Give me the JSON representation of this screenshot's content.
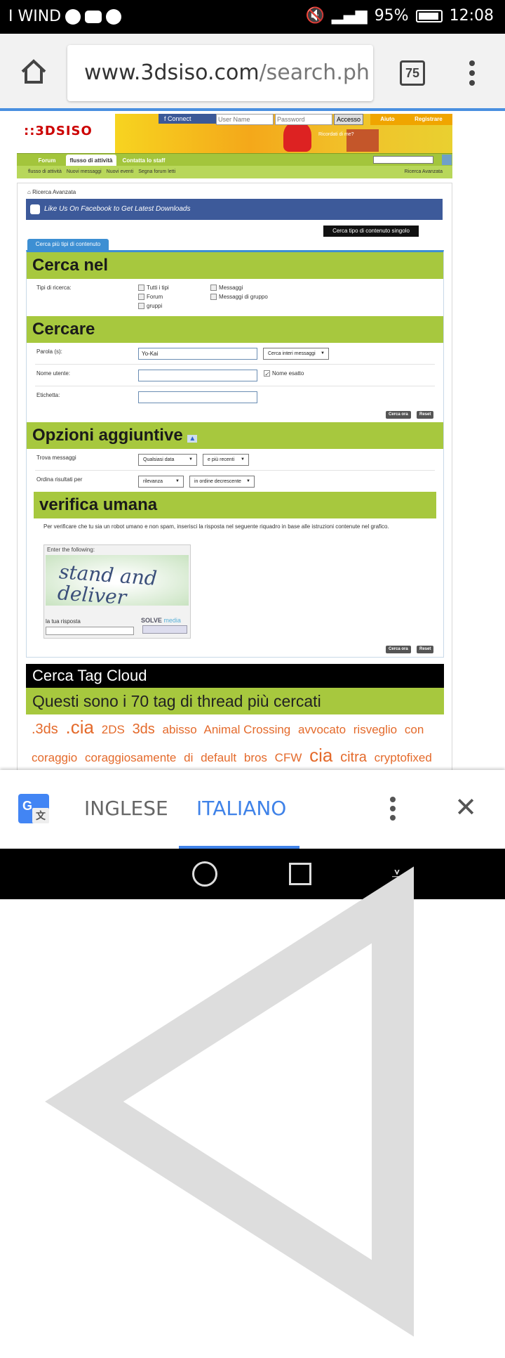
{
  "status_bar": {
    "carrier": "I WIND",
    "battery": "95%",
    "time": "12:08"
  },
  "browser": {
    "url_host": "www.3dsiso.com",
    "url_path": "/search.ph",
    "tab_count": "75"
  },
  "site": {
    "logo": "3DSISO",
    "fb_connect": "Connect",
    "username_placeholder": "User Name",
    "password_placeholder": "Password",
    "login_button": "Accesso",
    "help": "Aiuto",
    "register": "Registrare",
    "remember": "Ricordati di me?",
    "nav_tabs": [
      "Forum",
      "flusso di attività",
      "Contatta lo staff"
    ],
    "subnav_items": [
      "flusso di attività",
      "Nuovi messaggi",
      "Nuovi eventi",
      "Segna forum letti"
    ],
    "advanced_search": "Ricerca Avanzata"
  },
  "main": {
    "breadcrumb": "Ricerca Avanzata",
    "fb_banner": "Like Us On Facebook to Get Latest Downloads",
    "single_type_tab": "Cerca tipo di contenuto singolo",
    "multi_type_tab": "Cerca più tipi di contenuto",
    "search_in": {
      "heading": "Cerca nel",
      "label": "Tipi di ricerca:",
      "options": [
        "Tutti i tipi",
        "Forum",
        "gruppi",
        "Messaggi",
        "Messaggi di gruppo"
      ]
    },
    "search": {
      "heading": "Cercare",
      "word_label": "Parola (s):",
      "word_value": "Yo-Kai",
      "word_mode": "Cerca interi messaggi",
      "user_label": "Nome utente:",
      "exact_name": "Nome esatto",
      "tag_label": "Etichetta:",
      "search_now": "Cerca ora",
      "reset": "Reset"
    },
    "options": {
      "heading": "Opzioni aggiuntive",
      "find_label": "Trova messaggi",
      "find_date": "Qualsiasi data",
      "find_recent": "e più recenti",
      "sort_label": "Ordina risultati per",
      "sort_by": "rilevanza",
      "sort_order": "in ordine decrescente"
    },
    "human": {
      "heading": "verifica umana",
      "instructions": "Per verificare che tu sia un robot umano e non spam, inserisci la risposta nel seguente riquadro in base alle istruzioni contenute nel grafico.",
      "captcha_header": "Enter the following:",
      "captcha_line1": "stand and",
      "captcha_line2": "deliver",
      "answer_label": "la tua risposta",
      "brand": "SOLVE",
      "brand_suffix": "media"
    },
    "tag_cloud": {
      "heading": "Cerca Tag Cloud",
      "subheading": "Questi sono i 70 tag di thread più cercati",
      "tags": [
        ".3ds",
        ".cia",
        "2DS",
        "3ds",
        "abisso",
        "Animal Crossing",
        "avvocato",
        "risveglio",
        "con",
        "coraggio",
        "coraggiosamente",
        "di",
        "default",
        "bros",
        "CFW",
        "cia",
        "citra",
        "cryptofixed"
      ]
    }
  },
  "translate_bar": {
    "lang_from": "INGLESE",
    "lang_to": "ITALIANO"
  }
}
